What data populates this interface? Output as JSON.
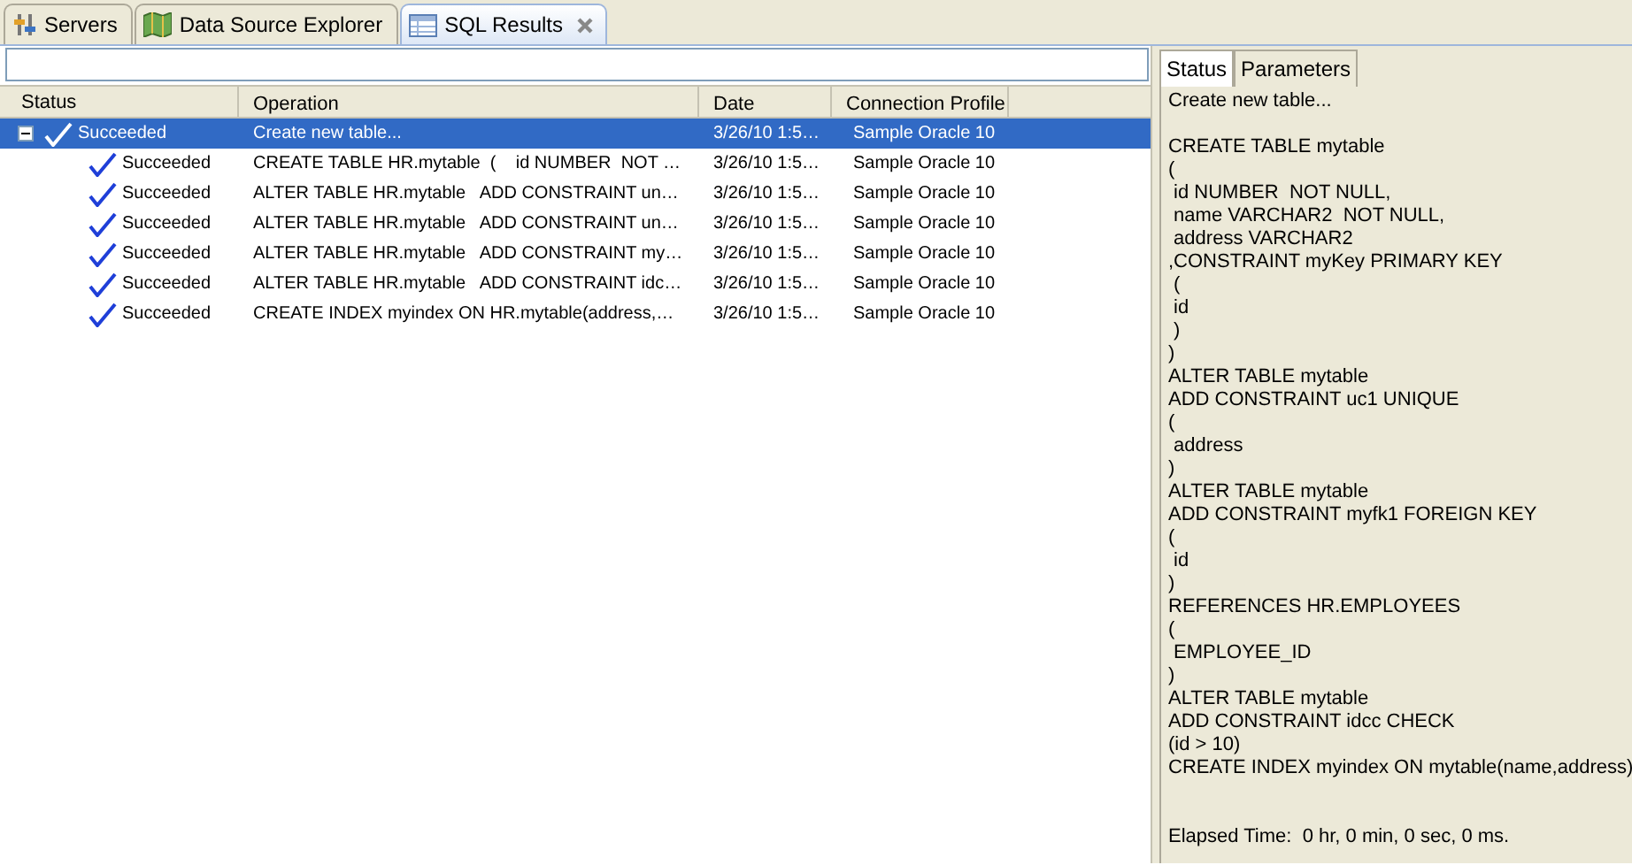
{
  "view_tabs": [
    {
      "label": "Servers",
      "selected": false
    },
    {
      "label": "Data Source Explorer",
      "selected": false
    },
    {
      "label": "SQL Results",
      "selected": true,
      "closable": true
    }
  ],
  "table": {
    "columns": [
      "Status",
      "Operation",
      "Date",
      "Connection Profile"
    ],
    "rows": [
      {
        "status": "Succeeded",
        "operation": "Create new table...",
        "date": "3/26/10 1:5…",
        "profile": "Sample Oracle 10",
        "expanded": true,
        "selected": true,
        "children": [
          {
            "status": "Succeeded",
            "operation": "CREATE TABLE HR.mytable  (    id NUMBER  NOT …",
            "date": "3/26/10 1:5…",
            "profile": "Sample Oracle 10",
            "selected": false
          },
          {
            "status": "Succeeded",
            "operation": "ALTER TABLE HR.mytable   ADD CONSTRAINT un…",
            "date": "3/26/10 1:5…",
            "profile": "Sample Oracle 10",
            "selected": false
          },
          {
            "status": "Succeeded",
            "operation": "ALTER TABLE HR.mytable   ADD CONSTRAINT un…",
            "date": "3/26/10 1:5…",
            "profile": "Sample Oracle 10",
            "selected": false
          },
          {
            "status": "Succeeded",
            "operation": "ALTER TABLE HR.mytable   ADD CONSTRAINT my…",
            "date": "3/26/10 1:5…",
            "profile": "Sample Oracle 10",
            "selected": false
          },
          {
            "status": "Succeeded",
            "operation": "ALTER TABLE HR.mytable   ADD CONSTRAINT idc…",
            "date": "3/26/10 1:5…",
            "profile": "Sample Oracle 10",
            "selected": false
          },
          {
            "status": "Succeeded",
            "operation": "CREATE INDEX myindex ON HR.mytable(address,…",
            "date": "3/26/10 1:5…",
            "profile": "Sample Oracle 10",
            "selected": false
          }
        ]
      }
    ]
  },
  "detail_tabs": [
    {
      "label": "Status",
      "selected": true
    },
    {
      "label": "Parameters",
      "selected": false
    }
  ],
  "detail": {
    "summary": "Create new table...",
    "statement_lines": [
      "CREATE TABLE mytable",
      "(",
      " id NUMBER  NOT NULL,",
      " name VARCHAR2  NOT NULL,",
      " address VARCHAR2",
      ",CONSTRAINT myKey PRIMARY KEY",
      " (",
      " id",
      " )",
      ")",
      "ALTER TABLE mytable",
      "ADD CONSTRAINT uc1 UNIQUE",
      "(",
      " address",
      ")",
      "ALTER TABLE mytable",
      "ADD CONSTRAINT myfk1 FOREIGN KEY",
      "(",
      " id",
      ")",
      "REFERENCES HR.EMPLOYEES",
      "(",
      " EMPLOYEE_ID",
      ")",
      "ALTER TABLE mytable",
      "ADD CONSTRAINT idcc CHECK",
      "(id > 10)",
      "CREATE INDEX myindex ON mytable(name,address)"
    ],
    "elapsed": "Elapsed Time:  0 hr, 0 min, 0 sec, 0 ms."
  }
}
